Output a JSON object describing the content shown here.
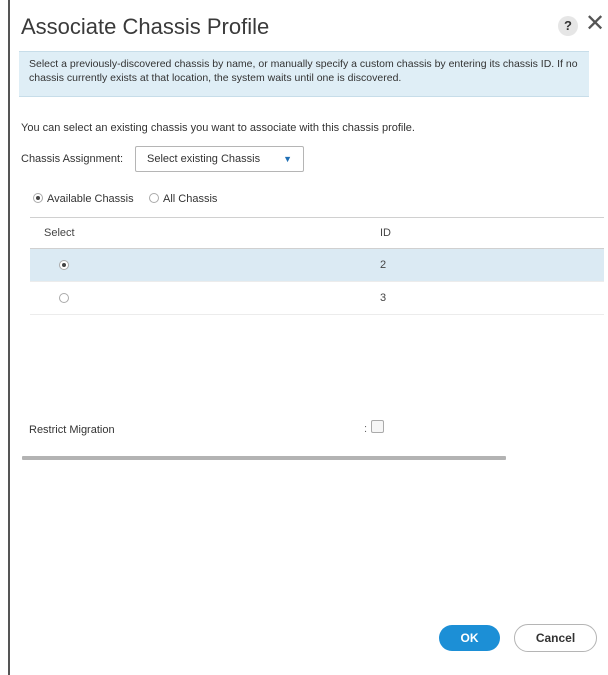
{
  "dialog": {
    "title": "Associate Chassis Profile",
    "help_label": "?",
    "close_label": "✕"
  },
  "info_text": "Select a previously-discovered chassis by name, or manually specify a custom chassis by entering its chassis ID. If no chassis currently exists at that location, the system waits until one is discovered.",
  "intro_text": "You can select an existing chassis you want to associate with this chassis profile.",
  "assignment": {
    "label": "Chassis Assignment:",
    "value": "Select existing Chassis"
  },
  "filter": {
    "available_label": "Available Chassis",
    "all_label": "All Chassis",
    "selected": "available"
  },
  "table": {
    "columns": [
      "Select",
      "ID"
    ],
    "rows": [
      {
        "id": "2",
        "selected": true
      },
      {
        "id": "3",
        "selected": false
      }
    ]
  },
  "restrict_migration": {
    "label": "Restrict Migration",
    "separator": ":",
    "checked": false
  },
  "buttons": {
    "ok": "OK",
    "cancel": "Cancel"
  },
  "colors": {
    "info_bg": "#dfeef6",
    "selected_row_bg": "#dbeaf3",
    "ok_bg": "#1c8fd6"
  }
}
